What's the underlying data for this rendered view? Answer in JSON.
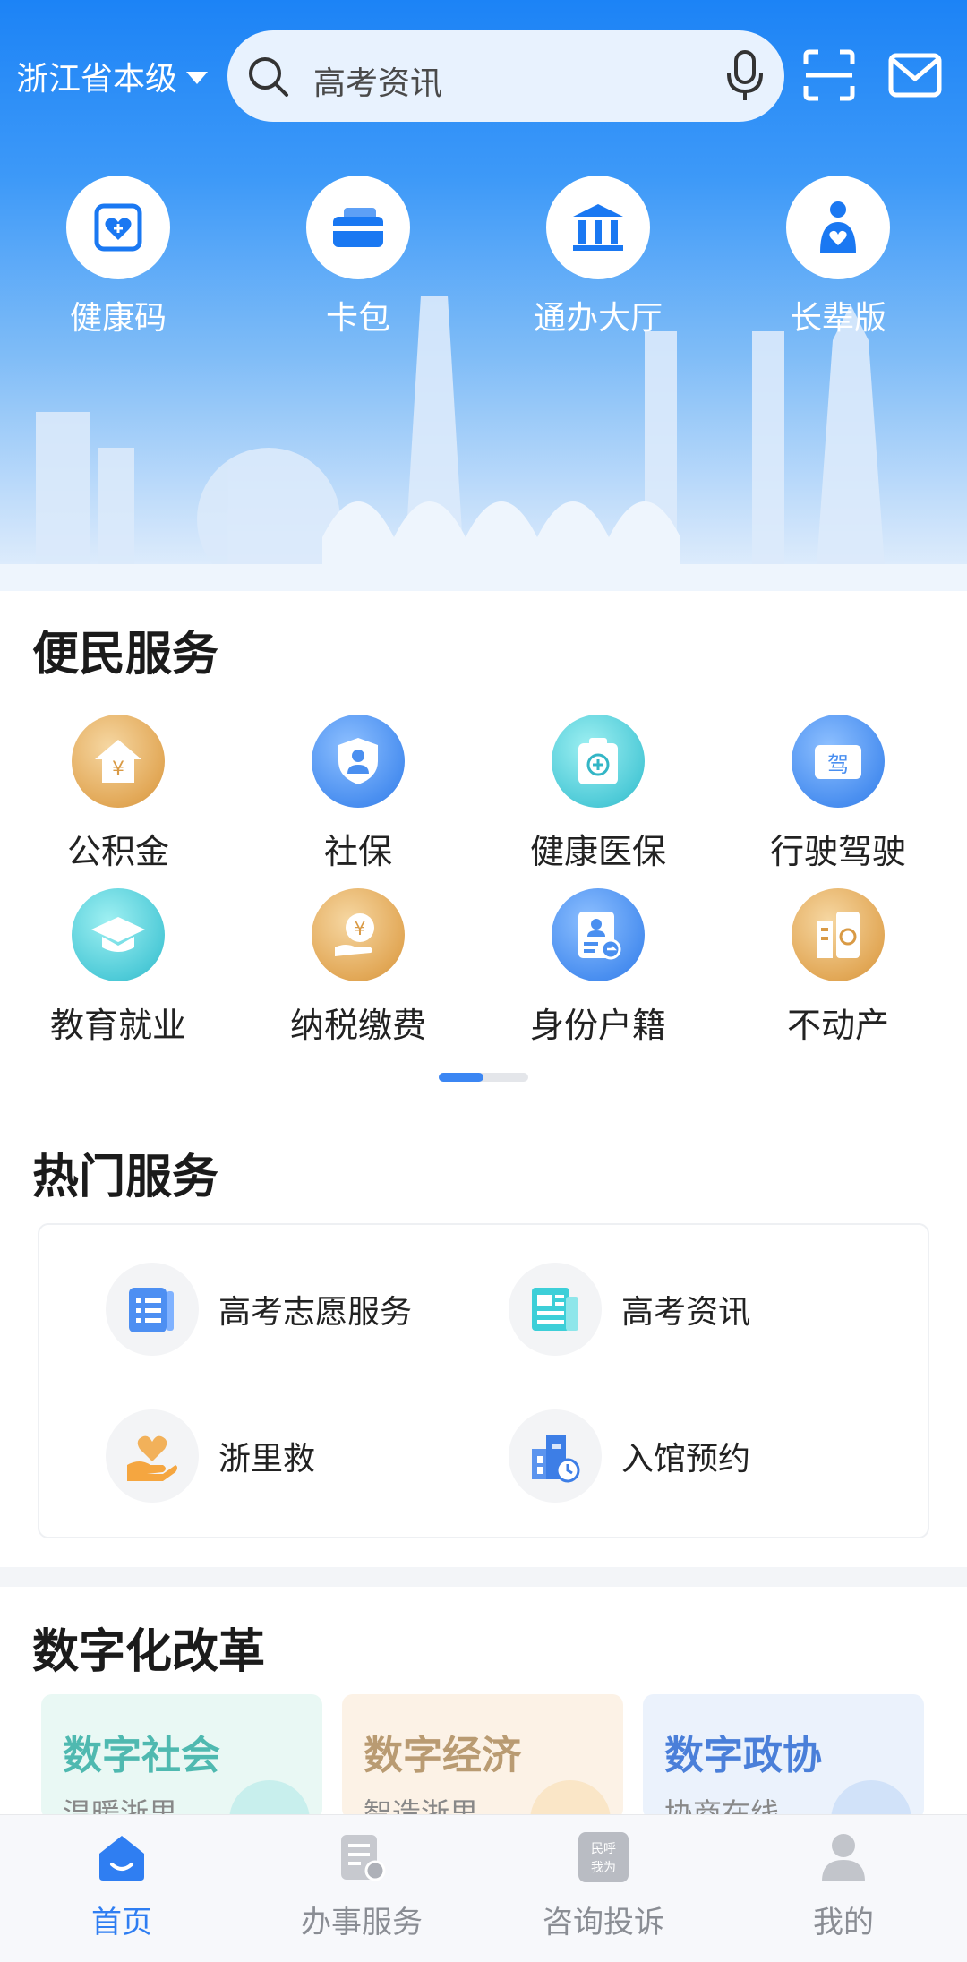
{
  "header": {
    "region": "浙江省本级",
    "search_placeholder": "高考资讯"
  },
  "quick_actions": [
    {
      "label": "健康码",
      "icon": "health-code-icon"
    },
    {
      "label": "卡包",
      "icon": "card-wallet-icon"
    },
    {
      "label": "通办大厅",
      "icon": "service-hall-icon"
    },
    {
      "label": "长辈版",
      "icon": "elder-mode-icon"
    }
  ],
  "convenience": {
    "title": "便民服务",
    "items": [
      {
        "label": "公积金",
        "icon": "housing-fund-icon",
        "color": "gold"
      },
      {
        "label": "社保",
        "icon": "social-security-icon",
        "color": "blue"
      },
      {
        "label": "健康医保",
        "icon": "medical-insurance-icon",
        "color": "teal"
      },
      {
        "label": "行驶驾驶",
        "icon": "driving-license-icon",
        "color": "blue"
      },
      {
        "label": "教育就业",
        "icon": "education-icon",
        "color": "teal"
      },
      {
        "label": "纳税缴费",
        "icon": "tax-payment-icon",
        "color": "gold"
      },
      {
        "label": "身份户籍",
        "icon": "household-id-icon",
        "color": "blue"
      },
      {
        "label": "不动产",
        "icon": "real-estate-icon",
        "color": "gold"
      }
    ],
    "page_indicator": {
      "pages": 2,
      "active": 1
    }
  },
  "hot_services": {
    "title": "热门服务",
    "items": [
      {
        "label": "高考志愿服务",
        "icon": "application-list-icon"
      },
      {
        "label": "高考资讯",
        "icon": "news-icon"
      },
      {
        "label": "浙里救",
        "icon": "heart-hand-icon"
      },
      {
        "label": "入馆预约",
        "icon": "building-clock-icon"
      }
    ]
  },
  "reform": {
    "title": "数字化改革",
    "cards": [
      {
        "title": "数字社会",
        "subtitle": "温暖浙里",
        "color": "#4fb9b0",
        "bg": "#e9f8f4"
      },
      {
        "title": "数字经济",
        "subtitle": "智造浙里",
        "color": "#b99b72",
        "bg": "#fcf2e6"
      },
      {
        "title": "数字政协",
        "subtitle": "协商在线",
        "color": "#4a7fd9",
        "bg": "#ebf2fc"
      }
    ]
  },
  "nav": {
    "tabs": [
      {
        "label": "首页",
        "icon": "home-icon"
      },
      {
        "label": "办事服务",
        "icon": "services-icon"
      },
      {
        "label": "咨询投诉",
        "icon": "consult-icon"
      },
      {
        "label": "我的",
        "icon": "profile-icon"
      }
    ],
    "active_index": 0,
    "consult_icon_text": "民呼我为"
  },
  "accent_color": "#2f7ef2"
}
